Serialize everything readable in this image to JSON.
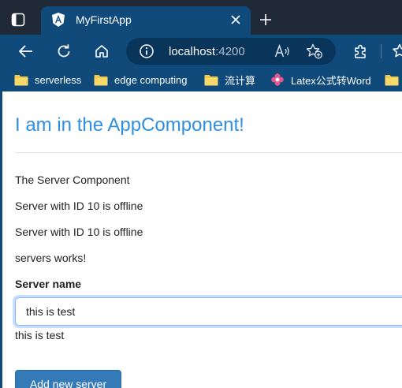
{
  "browser": {
    "tab": {
      "title": "MyFirstApp"
    },
    "address": {
      "host": "localhost",
      "port": ":4200"
    },
    "favorites": [
      {
        "label": "serverless",
        "icon": "folder-icon"
      },
      {
        "label": "edge computing",
        "icon": "folder-icon"
      },
      {
        "label": "流计算",
        "icon": "folder-icon"
      },
      {
        "label": "Latex公式转Word",
        "icon": "flower-icon"
      }
    ]
  },
  "page": {
    "heading": "I am in the AppComponent!",
    "server_component_line": "The Server Component",
    "server_status_lines": [
      "Server with ID 10 is offline",
      "Server with ID 10 is offline"
    ],
    "servers_works": "servers works!",
    "server_name_label": "Server name",
    "server_name_value": "this is test",
    "server_name_echo": "this is test",
    "add_server_label": "Add new server"
  },
  "colors": {
    "heading": "#2f8fe0",
    "browser_frame": "#0f4a7a",
    "tab_strip": "#202a36",
    "button": "#337ab7"
  }
}
